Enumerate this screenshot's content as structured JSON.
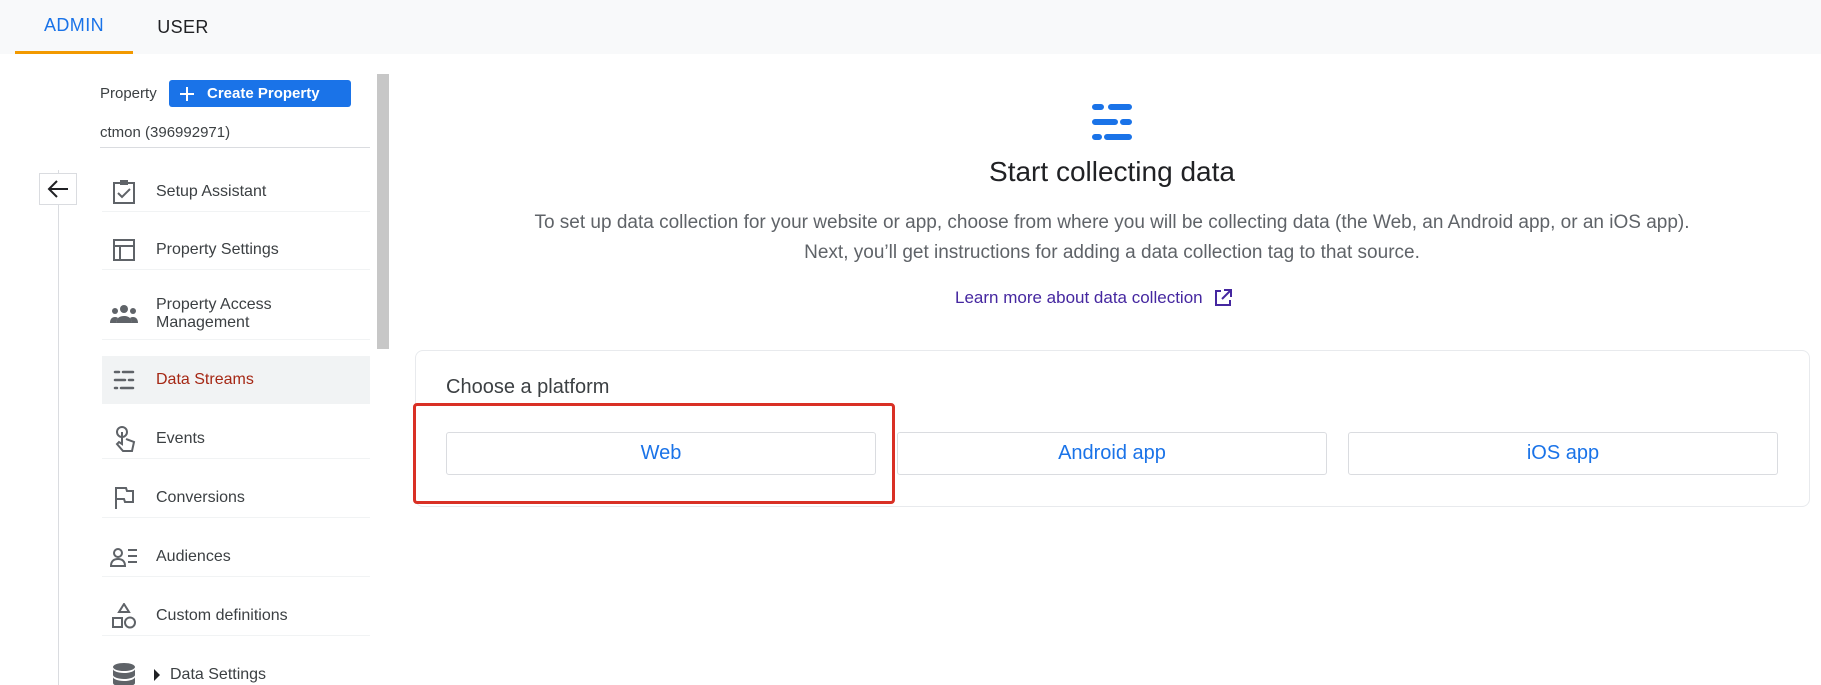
{
  "tabs": [
    {
      "label": "ADMIN",
      "active": true
    },
    {
      "label": "USER",
      "active": false
    }
  ],
  "property": {
    "label": "Property",
    "create_button": "Create Property",
    "name": "ctmon (396992971)"
  },
  "nav": [
    {
      "label": "Setup Assistant",
      "icon": "clipboard-check-icon"
    },
    {
      "label": "Property Settings",
      "icon": "layout-icon"
    },
    {
      "label": "Property Access Management",
      "icon": "people-icon"
    },
    {
      "label": "Data Streams",
      "icon": "data-streams-icon",
      "active": true
    },
    {
      "label": "Events",
      "icon": "touch-icon"
    },
    {
      "label": "Conversions",
      "icon": "flag-icon"
    },
    {
      "label": "Audiences",
      "icon": "audience-icon"
    },
    {
      "label": "Custom definitions",
      "icon": "shapes-icon"
    },
    {
      "label": "Data Settings",
      "icon": "database-icon"
    }
  ],
  "main": {
    "title": "Start collecting data",
    "description_line1": "To set up data collection for your website or app, choose from where you will be collecting data (the Web, an Android app, or an iOS app).",
    "description_line2": "Next, you’ll get instructions for adding a data collection tag to that source.",
    "learn_more": "Learn more about data collection",
    "platform_title": "Choose a platform",
    "platforms": [
      "Web",
      "Android app",
      "iOS app"
    ]
  },
  "colors": {
    "accent": "#1a73e8",
    "active_tab_underline": "#f29900",
    "active_nav_text": "#a52714",
    "highlight": "#d93025",
    "link": "#4527a0"
  }
}
